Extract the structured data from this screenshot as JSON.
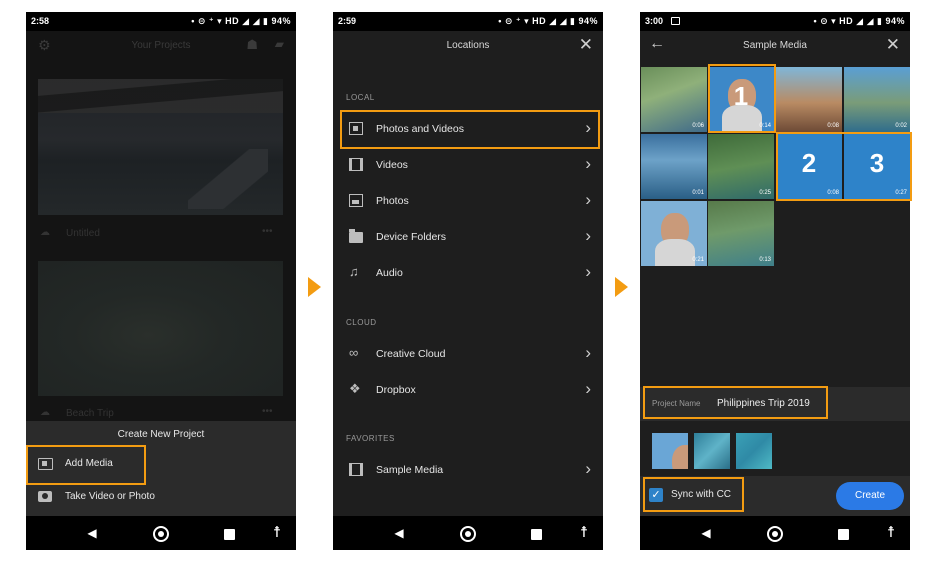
{
  "colors": {
    "accent_orange": "#f39c12",
    "primary_blue": "#2b7ae6",
    "check_blue": "#2e83c9",
    "dark_bg": "#1e1e1e"
  },
  "phone1": {
    "status": {
      "time": "2:58",
      "icons": "• ⊝ ⁺ ▾ HD ◢ ◢ ▮ 94%"
    },
    "header": {
      "title": "Your Projects"
    },
    "projects": [
      {
        "name": "Untitled"
      },
      {
        "name": "Beach Trip"
      }
    ],
    "sheet": {
      "title": "Create New Project",
      "items": [
        {
          "label": "Add Media"
        },
        {
          "label": "Take Video or Photo"
        }
      ]
    }
  },
  "phone2": {
    "status": {
      "time": "2:59",
      "icons": "• ⊝ ⁺ ▾ HD ◢ ◢ ▮ 94%"
    },
    "header": {
      "title": "Locations"
    },
    "sections": [
      {
        "title": "LOCAL",
        "items": [
          {
            "label": "Photos and Videos",
            "icon": "photos-videos-icon"
          },
          {
            "label": "Videos",
            "icon": "film-icon"
          },
          {
            "label": "Photos",
            "icon": "image-icon"
          },
          {
            "label": "Device Folders",
            "icon": "folder-icon"
          },
          {
            "label": "Audio",
            "icon": "music-note-icon"
          }
        ]
      },
      {
        "title": "CLOUD",
        "items": [
          {
            "label": "Creative Cloud",
            "icon": "creative-cloud-icon"
          },
          {
            "label": "Dropbox",
            "icon": "dropbox-icon"
          }
        ]
      },
      {
        "title": "FAVORITES",
        "items": [
          {
            "label": "Sample Media",
            "icon": "film-icon"
          }
        ]
      }
    ]
  },
  "phone3": {
    "status": {
      "time": "3:00",
      "icons": "• ⊝ ▾ HD ◢ ◢ ▮ 94%"
    },
    "header": {
      "title": "Sample Media"
    },
    "grid": [
      {
        "duration": "0:06",
        "selected": ""
      },
      {
        "duration": "0:14",
        "selected": "1"
      },
      {
        "duration": "0:08",
        "selected": ""
      },
      {
        "duration": "0:02",
        "selected": ""
      },
      {
        "duration": "0:01",
        "selected": ""
      },
      {
        "duration": "0:25",
        "selected": ""
      },
      {
        "duration": "0:08",
        "selected": "2"
      },
      {
        "duration": "0:27",
        "selected": "3"
      },
      {
        "duration": "0:21",
        "selected": ""
      },
      {
        "duration": "0:13",
        "selected": ""
      }
    ],
    "project_name": {
      "label": "Project Name",
      "value": "Philippines Trip 2019"
    },
    "sync": {
      "label": "Sync with CC",
      "checked": true
    },
    "create_label": "Create"
  }
}
